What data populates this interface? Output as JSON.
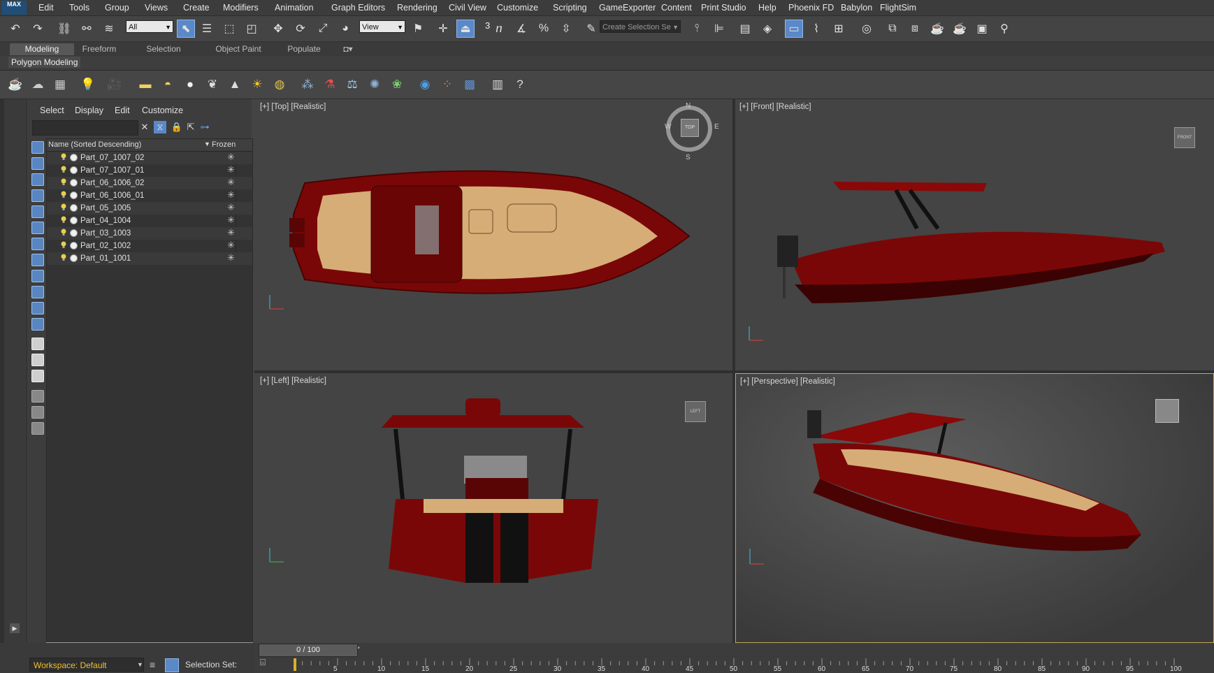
{
  "app": {
    "logo_text": "MAX",
    "accent": "#5b88c6"
  },
  "menubar": [
    "Edit",
    "Tools",
    "Group",
    "Views",
    "Create",
    "Modifiers",
    "Animation",
    "Graph Editors",
    "Rendering",
    "Civil View",
    "Customize",
    "Scripting",
    "GameExporter",
    "Content",
    "Print Studio",
    "Help",
    "Phoenix FD",
    "Babylon",
    "FlightSim"
  ],
  "toolbar": {
    "filter_select": "All",
    "refcoord_select": "View",
    "snap_value": "3",
    "selection_set_placeholder": "Create Selection Se"
  },
  "ribbon": {
    "tabs": [
      "Modeling",
      "Freeform",
      "Selection",
      "Object Paint",
      "Populate"
    ],
    "active_tab": "Modeling",
    "panel_label": "Polygon Modeling"
  },
  "explorer": {
    "menu": [
      "Select",
      "Display",
      "Edit",
      "Customize"
    ],
    "column_name": "Name (Sorted Descending)",
    "column_frozen": "Frozen",
    "rows": [
      "Part_07_1007_02",
      "Part_07_1007_01",
      "Part_06_1006_02",
      "Part_06_1006_01",
      "Part_05_1005",
      "Part_04_1004",
      "Part_03_1003",
      "Part_02_1002",
      "Part_01_1001"
    ]
  },
  "viewports": {
    "top": "[+] [Top] [Realistic]",
    "front": "[+] [Front] [Realistic]",
    "left": "[+] [Left] [Realistic]",
    "perspective": "[+] [Perspective] [Realistic]",
    "compass": {
      "n": "N",
      "s": "S",
      "e": "E",
      "w": "W",
      "center": "TOP"
    },
    "cube_front": "FRONT",
    "cube_left": "LEFT"
  },
  "timeline": {
    "frame_display": "0 / 100",
    "ticks": [
      "5",
      "10",
      "15",
      "20",
      "25",
      "30",
      "35",
      "40",
      "45",
      "50",
      "55",
      "60",
      "65",
      "70",
      "75",
      "80",
      "85",
      "90",
      "95",
      "100"
    ]
  },
  "statusbar": {
    "workspace": "Workspace: Default",
    "selection_set": "Selection Set:"
  },
  "colors": {
    "boat_hull": "#8b0a0a",
    "boat_interior": "#d9b27c",
    "active_viewport_border": "#c2a95a"
  }
}
